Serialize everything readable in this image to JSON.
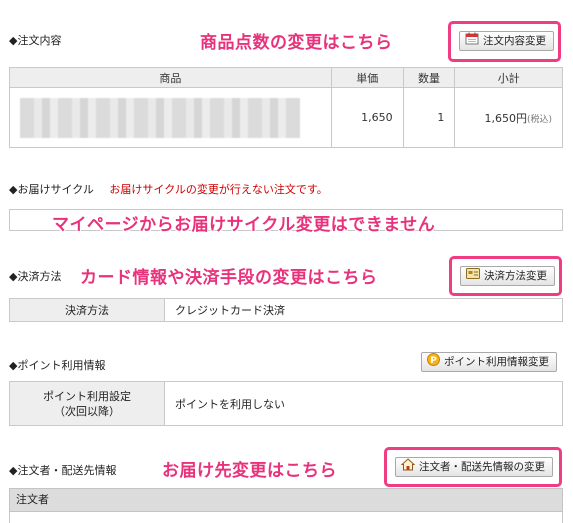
{
  "order_contents": {
    "heading": "◆注文内容",
    "annotation": "商品点数の変更はこちら",
    "button_label": "注文内容変更",
    "columns": [
      "商品",
      "単価",
      "数量",
      "小計"
    ],
    "row": {
      "unit_price": "1,650",
      "quantity": "1",
      "subtotal": "1,650円",
      "tax": "(税込)"
    }
  },
  "delivery_cycle": {
    "heading": "◆お届けサイクル",
    "warning": "お届けサイクルの変更が行えない注文です。",
    "annotation": "マイページからお届けサイクル変更はできません"
  },
  "payment": {
    "heading": "◆決済方法",
    "annotation": "カード情報や決済手段の変更はこちら",
    "button_label": "決済方法変更",
    "key": "決済方法",
    "value": "クレジットカード決済"
  },
  "points": {
    "heading": "◆ポイント利用情報",
    "button_label": "ポイント利用情報変更",
    "key_line1": "ポイント利用設定",
    "key_line2": "（次回以降）",
    "value": "ポイントを利用しない"
  },
  "orderer": {
    "heading": "◆注文者・配送先情報",
    "annotation": "お届け先変更はこちら",
    "button_label": "注文者・配送先情報の変更",
    "section_label": "注文者"
  },
  "colors": {
    "annotation": "#e8327c",
    "highlight_border": "#ef3c83",
    "warning": "#cc0000"
  }
}
